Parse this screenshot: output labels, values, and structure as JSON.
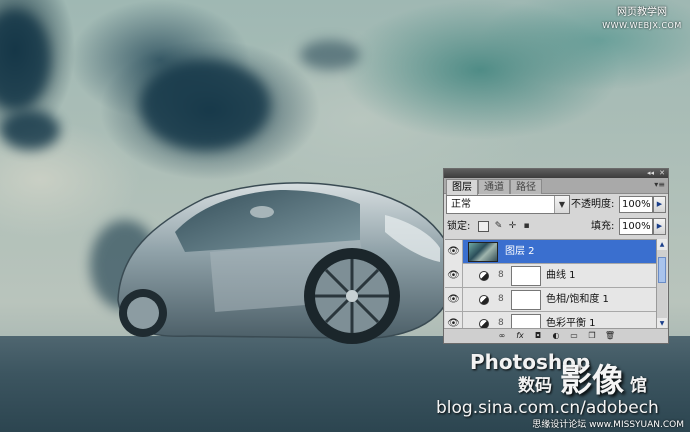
{
  "watermark": {
    "site_cn": "网页教学网",
    "site_url": "WWW.WEBJX.COM",
    "photoshop": "Photoshop",
    "digital": "数码",
    "image": "影像",
    "hall": "馆",
    "blog": "blog.sina.com.cn/adobech",
    "bottom": "思缘设计论坛 www.MISSYUAN.COM"
  },
  "panel": {
    "tabs": [
      "图层",
      "通道",
      "路径"
    ],
    "active_tab": 0,
    "blend_mode": "正常",
    "opacity_label": "不透明度:",
    "opacity_value": "100%",
    "lock_label": "锁定:",
    "fill_label": "填充:",
    "fill_value": "100%",
    "layers": [
      {
        "name": "图层 2",
        "selected": true,
        "type": "pixel"
      },
      {
        "name": "曲线 1",
        "selected": false,
        "type": "adjustment"
      },
      {
        "name": "色相/饱和度 1",
        "selected": false,
        "type": "adjustment"
      },
      {
        "name": "色彩平衡 1",
        "selected": false,
        "type": "adjustment"
      }
    ]
  },
  "colors": {
    "selection": "#3a6fcf",
    "panel_bg": "#d6d6d6"
  }
}
